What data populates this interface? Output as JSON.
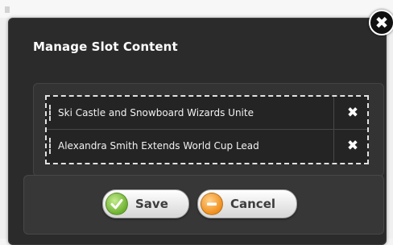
{
  "dialog": {
    "title": "Manage Slot Content",
    "close_label": "✖"
  },
  "slots": [
    {
      "label": "Ski Castle and Snowboard Wizards Unite",
      "remove_label": "✖"
    },
    {
      "label": "Alexandra Smith Extends World Cup Lead",
      "remove_label": "✖"
    }
  ],
  "buttons": {
    "save_label": "Save",
    "cancel_label": "Cancel"
  },
  "icons": {
    "close": "close-icon",
    "save": "checkmark-icon",
    "cancel": "minus-icon",
    "remove": "remove-icon"
  },
  "colors": {
    "dialog_bg": "#2b2b2b",
    "save_accent": "#6cb12f",
    "cancel_accent": "#f08f1c"
  }
}
